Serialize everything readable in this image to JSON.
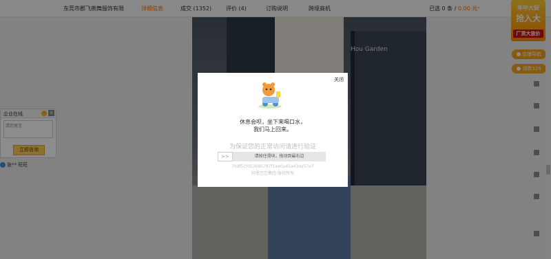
{
  "topbar": {
    "shop_name": "东莞市郡飞燕舞服饰有限",
    "tabs": [
      {
        "label": "详细信息",
        "active": true
      },
      {
        "label": "成交 (1352)",
        "active": false
      },
      {
        "label": "评价 (4)",
        "active": false
      },
      {
        "label": "订购说明",
        "active": false
      },
      {
        "label": "跨境商机",
        "active": false
      }
    ],
    "selected_prefix": "已选 0 条 / ",
    "selected_price": "0.00 元",
    "caret_icon": "chevron-down-icon"
  },
  "right_ads": {
    "banner_line1": "年中大促",
    "banner_line2": "抢入大",
    "banner_line3": "厂货大放价",
    "pill_nav": "店铺导航",
    "pill_coupon": "领券328"
  },
  "photo": {
    "sign_text": "Hou Garden"
  },
  "left_widget": {
    "title": "企业在线",
    "placeholder": "请您留言",
    "submit_label": "立即咨询",
    "contact_label": "张** 旺旺"
  },
  "modal": {
    "close_label": "关闭",
    "message_line1": "休息会呗，坐下来喝口水，",
    "message_line2": "我们马上回来。",
    "verify_title": "为保证您的正常访问请进行验证",
    "slider_handle": ">>",
    "slider_label": "请按住滑块，拖动到最右边",
    "token": "7bdf5cfd53680797f1a40a45a43da57e7",
    "domain": "阿里巴巴集团 版权所有"
  },
  "colors": {
    "accent": "#ff6a00",
    "overlay": "#000000",
    "slider_bg": "#e6e6e6"
  }
}
